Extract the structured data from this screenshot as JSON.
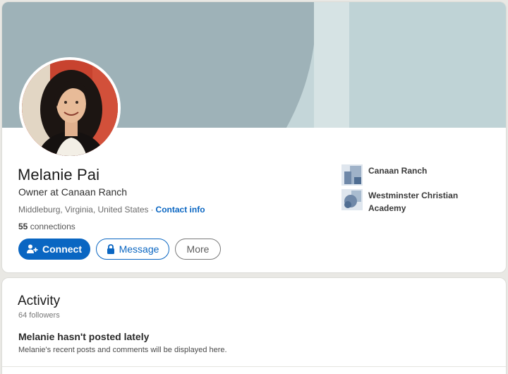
{
  "profile": {
    "name": "Melanie Pai",
    "headline": "Owner at Canaan Ranch",
    "location": "Middleburg, Virginia, United States",
    "separator": "·",
    "contact_info_label": "Contact info",
    "connections_count": "55",
    "connections_label": "connections",
    "avatar_icon": "profile-photo"
  },
  "actions": {
    "connect_label": "Connect",
    "connect_icon": "add-person-icon",
    "message_label": "Message",
    "message_icon": "lock-icon",
    "more_label": "More"
  },
  "organizations": [
    {
      "label": "Canaan Ranch",
      "icon": "company-logo-icon"
    },
    {
      "label": "Westminster Christian Academy",
      "icon": "school-logo-icon"
    }
  ],
  "activity": {
    "title": "Activity",
    "followers": "64 followers",
    "empty_title": "Melanie hasn't posted lately",
    "empty_description": "Melanie's recent posts and comments will be displayed here."
  },
  "colors": {
    "accent": "#0a66c2",
    "banner_dark": "#9eb2b8",
    "banner_light": "#c4d6d9",
    "page_background": "#e9e8e4"
  }
}
